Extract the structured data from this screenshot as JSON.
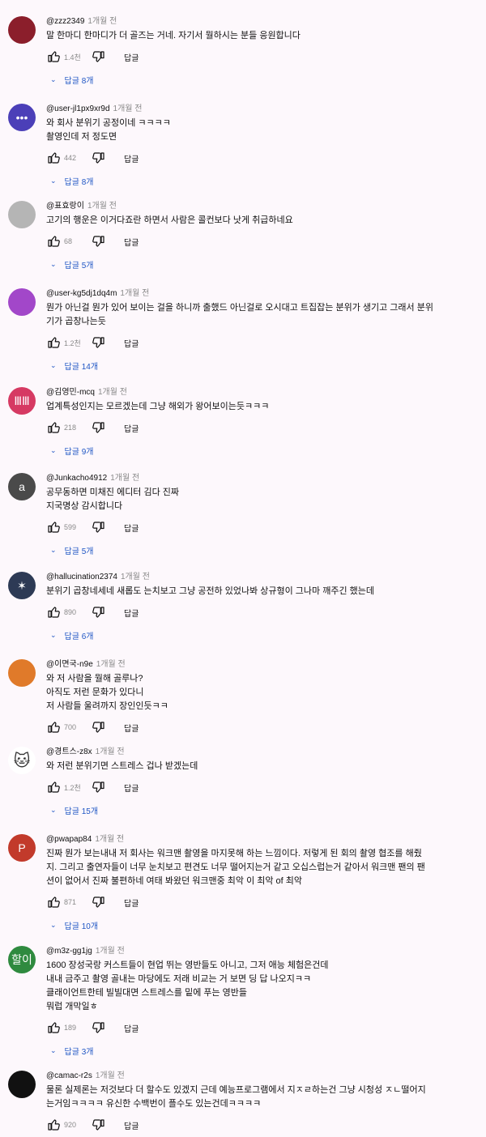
{
  "labels": {
    "reply": "답글"
  },
  "comments": [
    {
      "handle": "@zzz2349",
      "time": "1개월 전",
      "text": [
        "말 한마디 한마디가 더 골즈는 거네. 자기서 뭘하시는 분들 응원합니다"
      ],
      "likes": "1.4천",
      "replies": "답글 8개",
      "avatar_color": "#8b1e2b",
      "avatar_text": ""
    },
    {
      "handle": "@user-jl1px9xr9d",
      "time": "1개월 전",
      "text": [
        "와 회사 분위기 공정이네 ㅋㅋㅋㅋ",
        "촬영인데 저 정도면"
      ],
      "likes": "442",
      "replies": "답글 8개",
      "avatar_color": "#4b3fb8",
      "avatar_text": "•••"
    },
    {
      "handle": "@표효랑이",
      "time": "1개월 전",
      "text": [
        "고기의 행운은 이거다죠란 하면서 사람은 콜컨보다 낫게 취급하네요"
      ],
      "likes": "68",
      "replies": "답글 5개",
      "avatar_color": "#b5b5b5",
      "avatar_text": ""
    },
    {
      "handle": "@user-kg5dj1dq4m",
      "time": "1개월 전",
      "text": [
        "뭔가 아닌걸 뭔가 있어 보이는 걸을 하니까 출했드 아닌걸로 오시대고 트집잡는 분위가 생기고 그래서 분위",
        "기가 곱창나는듯"
      ],
      "likes": "1.2천",
      "replies": "답글 14개",
      "avatar_color": "#a247c9",
      "avatar_text": ""
    },
    {
      "handle": "@김영민-mcq",
      "time": "1개월 전",
      "text": [
        "업계특성인지는 모르겠는데 그냥 해외가 왕어보이는듯ㅋㅋㅋ"
      ],
      "likes": "218",
      "replies": "답글 9개",
      "avatar_color": "#d63a63",
      "avatar_text": "ⅢⅢ"
    },
    {
      "handle": "@Junkacho4912",
      "time": "1개월 전",
      "text": [
        "공무동하면 미채진 에디터 김다 진짜",
        "지국명상 감시합니다"
      ],
      "likes": "599",
      "replies": "답글 5개",
      "avatar_color": "#4a4a4a",
      "avatar_text": "a"
    },
    {
      "handle": "@hallucination2374",
      "time": "1개월 전",
      "text": [
        "분위기 곱창네세네 새롭도 는치보고 그냥 공전하 있었나봐 상규형이 그나마 깨주긴 했는데"
      ],
      "likes": "890",
      "replies": "답글 6개",
      "avatar_color": "#2d3a55",
      "avatar_text": "✶"
    },
    {
      "handle": "@이면국-n9e",
      "time": "1개월 전",
      "text": [
        "와 저 사람을 뭘해 골루나?",
        "아직도 저런 문화가 있다니",
        "저 사람들 울려까지 장인인듯ㅋㅋ"
      ],
      "likes": "700",
      "replies": "",
      "avatar_color": "#e07a2a",
      "avatar_text": ""
    },
    {
      "handle": "@경트스-z8x",
      "time": "1개월 전",
      "text": [
        "와 저런 분위기면 스트레스 겁나 받겠는데"
      ],
      "likes": "1.2천",
      "replies": "답글 15개",
      "avatar_color": "#ffffff",
      "avatar_text": "🐱"
    },
    {
      "handle": "@pwapap84",
      "time": "1개월 전",
      "text": [
        "진짜 뭔가 보는내내 저 회사는 워크맨 촬영을 마지못해 하는 느낌이다.  저렇게 된 회의 촬영 협조를 해줬",
        "지. 그리고 출연자들이 너무 눈치보고 편견도 너무 떨어지는거 같고 오십스럽는거 같아서 워크맨 팬의 팬",
        "션이 없어서 진짜 불편하네 여태 봐왔던 워크맨중 최악 이 최악 of 최악"
      ],
      "likes": "871",
      "replies": "답글 10개",
      "avatar_color": "#c23a2b",
      "avatar_text": "P"
    },
    {
      "handle": "@m3z-gg1jg",
      "time": "1개월 전",
      "text": [
        "1600 장성국랑 커스트들이 현업 뛰는 영반들도 아니고, 그저 애능 체험은건데",
        "내내 금주고 촬영 골내는 마당에도 저래 비교는 거 보면 딩 답 나오지ㅋㅋ",
        "클래이언트한테 빌빌대면 스트레스를 밑에 푸는 영반들",
        "뭐럽 개막일ㅎ"
      ],
      "likes": "189",
      "replies": "답글 3개",
      "avatar_color": "#2f8a3f",
      "avatar_text": "할이"
    },
    {
      "handle": "@camac-r2s",
      "time": "1개월 전",
      "text": [
        "물론 실제론는 저것보다 더 할수도 있겠지 근데 예능프로그램에서 지ㅈㄹ하는건 그냥 시청성 ㅈㄴ떨어지",
        "는거임ㅋㅋㅋㅋ 유신한 수백번이 플수도 있는건데ㅋㅋㅋㅋ"
      ],
      "likes": "920",
      "replies": "",
      "avatar_color": "#111111",
      "avatar_text": ""
    }
  ]
}
